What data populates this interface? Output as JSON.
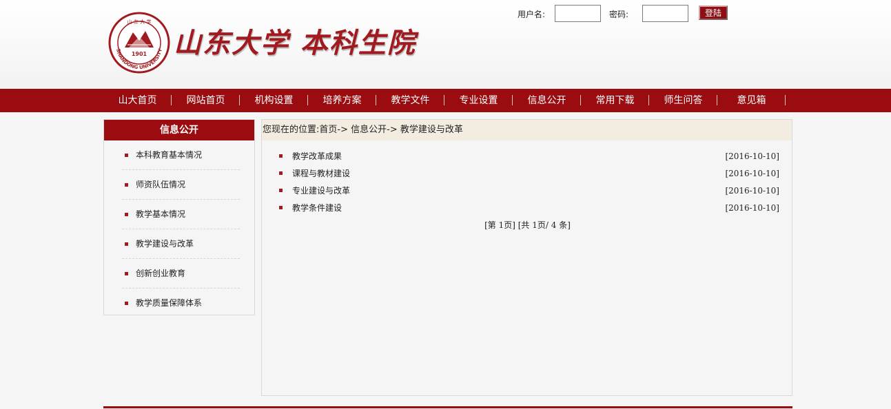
{
  "header": {
    "logo_text": "山东大学 本科生院",
    "seal": {
      "year": "1901",
      "ring_text": "SHANDONG UNIVERSITY",
      "top_chars": "山 东 大 学"
    }
  },
  "login": {
    "username_label": "用户名:",
    "username_value": "",
    "password_label": "密码:",
    "password_value": "",
    "submit_label": "登陆"
  },
  "nav": {
    "items": [
      {
        "label": "山大首页"
      },
      {
        "label": "网站首页"
      },
      {
        "label": "机构设置"
      },
      {
        "label": "培养方案"
      },
      {
        "label": "教学文件"
      },
      {
        "label": "专业设置"
      },
      {
        "label": "信息公开"
      },
      {
        "label": "常用下载"
      },
      {
        "label": "师生问答"
      },
      {
        "label": "意见箱"
      }
    ]
  },
  "sidebar": {
    "title": "信息公开",
    "items": [
      {
        "label": "本科教育基本情况"
      },
      {
        "label": "师资队伍情况"
      },
      {
        "label": "教学基本情况"
      },
      {
        "label": "教学建设与改革"
      },
      {
        "label": "创新创业教育"
      },
      {
        "label": "教学质量保障体系"
      }
    ]
  },
  "breadcrumb": {
    "prefix": "您现在的位置:",
    "home": "首页",
    "sep1": "->",
    "section": "信息公开",
    "sep2": "->",
    "current": "教学建设与改革"
  },
  "articles": [
    {
      "title": "教学改革成果",
      "date": "[2016-10-10]"
    },
    {
      "title": "课程与教材建设",
      "date": "[2016-10-10]"
    },
    {
      "title": "专业建设与改革",
      "date": "[2016-10-10]"
    },
    {
      "title": "教学条件建设",
      "date": "[2016-10-10]"
    }
  ],
  "pager": {
    "text": "[第  1页] [共  1页/ 4 条]"
  },
  "colors": {
    "brand_red": "#9b0c10",
    "breadcrumb_bg": "#f2ede0",
    "page_bg": "#f5f5f5"
  }
}
